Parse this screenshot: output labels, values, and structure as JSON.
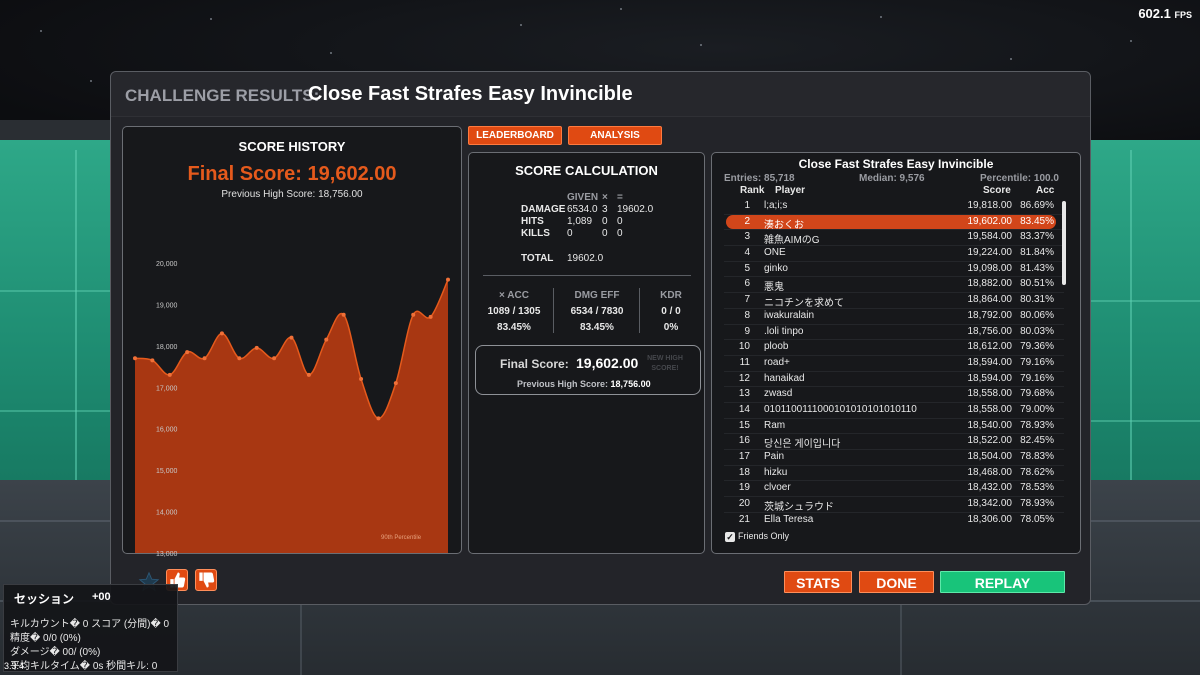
{
  "fps": "602.1",
  "fps_unit": "FPS",
  "dialog": {
    "title_prefix": "CHALLENGE RESULTS:",
    "title_name": "Close Fast Strafes Easy Invincible"
  },
  "score_history": {
    "title": "SCORE HISTORY",
    "final_score": "Final Score: 19,602.00",
    "previous_high": "Previous High Score: 18,756.00",
    "percentile_label": "90th Percentile",
    "chart_data": {
      "type": "area",
      "title": "SCORE HISTORY",
      "ylim": [
        13000,
        20000
      ],
      "y_ticks": [
        "20,000",
        "19,000",
        "18,000",
        "17,000",
        "16,000",
        "15,000",
        "14,000",
        "13,000"
      ],
      "y_tick_values": [
        20000,
        19000,
        18000,
        17000,
        16000,
        15000,
        14000,
        13000
      ],
      "values": [
        17700,
        17650,
        17300,
        17850,
        17700,
        18300,
        17700,
        17950,
        17700,
        18200,
        17300,
        18150,
        18750,
        17200,
        16250,
        17100,
        18750,
        18700,
        19600
      ],
      "color": "#c23d10",
      "line_color": "#e55a1c"
    }
  },
  "tabs": {
    "leaderboard": "LEADERBOARD",
    "analysis": "ANALYSIS"
  },
  "score_calc": {
    "title": "SCORE CALCULATION",
    "col_given": "GIVEN",
    "col_times": "×",
    "col_equals": "=",
    "rows": [
      {
        "label": "DAMAGE",
        "given": "6534.0",
        "mult": "3",
        "result": "19602.0"
      },
      {
        "label": "HITS",
        "given": "1,089",
        "mult": "0",
        "result": "0"
      },
      {
        "label": "KILLS",
        "given": "0",
        "mult": "0",
        "result": "0"
      }
    ],
    "total_label": "TOTAL",
    "total_value": "19602.0",
    "stats": [
      {
        "label": "× ACC",
        "value": "1089 / 1305",
        "pct": "83.45%"
      },
      {
        "label": "DMG EFF",
        "value": "6534 / 7830",
        "pct": "83.45%"
      },
      {
        "label": "KDR",
        "value": "0 / 0",
        "pct": "0%"
      }
    ],
    "final_label": "Final Score:",
    "final_value": "19,602.00",
    "new_high_line1": "NEW HIGH",
    "new_high_line2": "SCORE!",
    "prev_label": "Previous High Score:",
    "prev_value": "18,756.00"
  },
  "leaderboard": {
    "title": "Close Fast Strafes Easy Invincible",
    "entries": "Entries: 85,718",
    "median": "Median: 9,576",
    "percentile": "Percentile: 100.0",
    "headers": {
      "rank": "Rank",
      "player": "Player",
      "score": "Score",
      "acc": "Acc"
    },
    "highlight_rank": "2",
    "rows": [
      {
        "rank": "1",
        "player": "l;a;i;s",
        "score": "19,818.00",
        "acc": "86.69%"
      },
      {
        "rank": "2",
        "player": "湊おくお",
        "score": "19,602.00",
        "acc": "83.45%"
      },
      {
        "rank": "3",
        "player": "雑魚AIMのG",
        "score": "19,584.00",
        "acc": "83.37%"
      },
      {
        "rank": "4",
        "player": "ONE",
        "score": "19,224.00",
        "acc": "81.84%"
      },
      {
        "rank": "5",
        "player": "ginko",
        "score": "19,098.00",
        "acc": "81.43%"
      },
      {
        "rank": "6",
        "player": "悪鬼",
        "score": "18,882.00",
        "acc": "80.51%"
      },
      {
        "rank": "7",
        "player": "ニコチンを求めて",
        "score": "18,864.00",
        "acc": "80.31%"
      },
      {
        "rank": "8",
        "player": "iwakuralain",
        "score": "18,792.00",
        "acc": "80.06%"
      },
      {
        "rank": "9",
        "player": ".loli tinpo",
        "score": "18,756.00",
        "acc": "80.03%"
      },
      {
        "rank": "10",
        "player": "ploob",
        "score": "18,612.00",
        "acc": "79.36%"
      },
      {
        "rank": "11",
        "player": "road+",
        "score": "18,594.00",
        "acc": "79.16%"
      },
      {
        "rank": "12",
        "player": "hanaikad",
        "score": "18,594.00",
        "acc": "79.16%"
      },
      {
        "rank": "13",
        "player": "zwasd",
        "score": "18,558.00",
        "acc": "79.68%"
      },
      {
        "rank": "14",
        "player": "0101100111000101010101010110",
        "score": "18,558.00",
        "acc": "79.00%"
      },
      {
        "rank": "15",
        "player": "Ram",
        "score": "18,540.00",
        "acc": "78.93%"
      },
      {
        "rank": "16",
        "player": "당신은 게이입니다",
        "score": "18,522.00",
        "acc": "82.45%"
      },
      {
        "rank": "17",
        "player": "Pain",
        "score": "18,504.00",
        "acc": "78.83%"
      },
      {
        "rank": "18",
        "player": "hizku",
        "score": "18,468.00",
        "acc": "78.62%"
      },
      {
        "rank": "19",
        "player": "clvoer",
        "score": "18,432.00",
        "acc": "78.53%"
      },
      {
        "rank": "20",
        "player": "茨城シュラウド",
        "score": "18,342.00",
        "acc": "78.93%"
      },
      {
        "rank": "21",
        "player": "Ella Teresa",
        "score": "18,306.00",
        "acc": "78.05%"
      }
    ],
    "friends_only": "Friends Only",
    "friends_only_checked": true
  },
  "footer": {
    "stats": "STATS",
    "done": "DONE",
    "replay": "REPLAY",
    "icons": [
      "star-icon",
      "thumbs-up-icon",
      "thumbs-down-icon"
    ]
  },
  "session": {
    "title": "セッション",
    "title_right": "+00",
    "lines": [
      "キルカウント� 0 スコア (分間)� 0",
      "精度� 0/0 (0%)",
      "ダメージ� 00/ (0%)",
      "平均キルタイム� 0s    秒間キル: 0"
    ]
  },
  "version": "3.3.4",
  "colors": {
    "accent": "#e04a12",
    "replay": "#18c47a",
    "panel": "#17181b",
    "dialog": "#232429",
    "wall": "#1f8e73"
  }
}
